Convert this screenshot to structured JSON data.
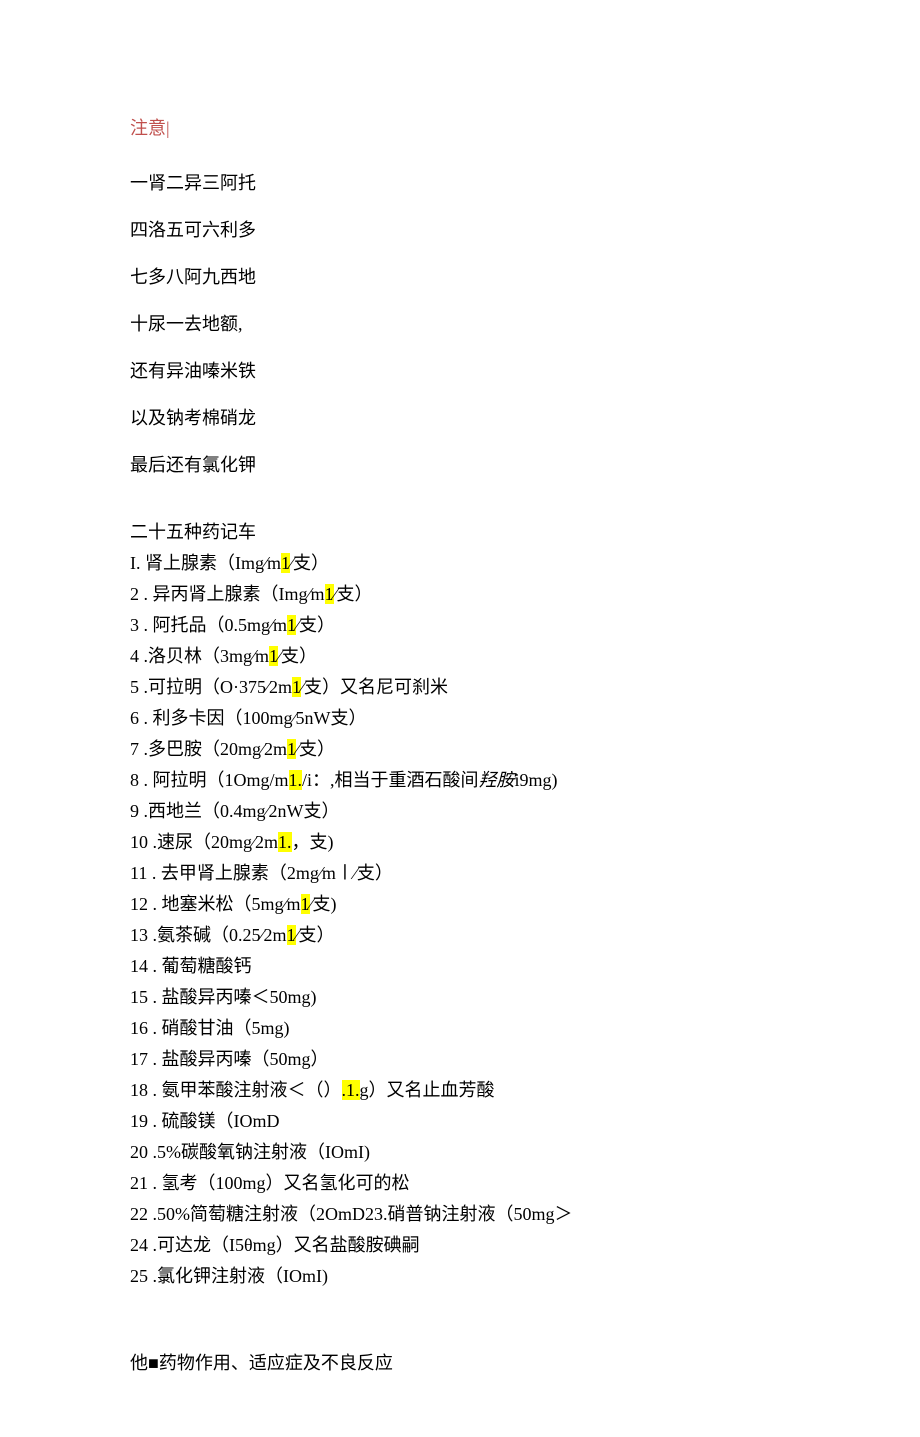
{
  "header": "注意|",
  "mnemonic": [
    "一肾二异三阿托",
    "四洛五可六利多",
    "七多八阿九西地",
    "十尿一去地额,",
    "还有异油嗪米铁",
    "以及钠考棉硝龙",
    "最后还有氯化钾"
  ],
  "list_title": "二十五种药记车",
  "drugs": [
    {
      "num": "I.",
      "pre": " 肾上腺素（Img⁄m",
      "hl": "1",
      "post": "⁄支）"
    },
    {
      "num": "2",
      "pre": " . 异丙肾上腺素（Img⁄m",
      "hl": "1",
      "post": "⁄支）"
    },
    {
      "num": "3",
      "pre": " . 阿托品（0.5mg⁄m",
      "hl": "1",
      "post": "⁄支）"
    },
    {
      "num": "4",
      "pre": " .洛贝林（3mg⁄m",
      "hl": "1",
      "post": "⁄支）"
    },
    {
      "num": "5",
      "pre": " .可拉明（O·375⁄2m",
      "hl": "1",
      "post": "⁄支）又名尼可刹米"
    },
    {
      "num": "6",
      "pre": " . 利多卡因（100mg⁄5nW支）",
      "hl": "",
      "post": ""
    },
    {
      "num": "7",
      "pre": " .多巴胺（20mg⁄2m",
      "hl": "1",
      "post": "⁄支）"
    },
    {
      "num": "8",
      "pre": " . 阿拉明（1Omg/m",
      "hl": "1.",
      "post": "/i：,相当于重酒石酸间",
      "italic": "羟胺",
      "post2": "i9mg)"
    },
    {
      "num": "9",
      "pre": " .西地兰（0.4mg⁄2nW支）",
      "hl": "",
      "post": ""
    },
    {
      "num": "10",
      "pre": " .速尿（20mg⁄2m",
      "hl": "1.",
      "post": "，支)"
    },
    {
      "num": "11",
      "pre": " . 去甲肾上腺素（2mg⁄m㇑⁄支）",
      "hl": "",
      "post": ""
    },
    {
      "num": "12",
      "pre": " . 地塞米松（5mg⁄m",
      "hl": "1",
      "post": "⁄支)"
    },
    {
      "num": "13",
      "pre": " .氨茶碱（0.25⁄2m",
      "hl": "1",
      "post": "⁄支）"
    },
    {
      "num": "14",
      "pre": " . 葡萄糖酸钙",
      "hl": "",
      "post": ""
    },
    {
      "num": "15",
      "pre": " . 盐酸异丙嗪＜50mg)",
      "hl": "",
      "post": ""
    },
    {
      "num": "16",
      "pre": " . 硝酸甘油（5mg)",
      "hl": "",
      "post": ""
    },
    {
      "num": "17",
      "pre": " . 盐酸异丙嗪（50mg）",
      "hl": "",
      "post": ""
    },
    {
      "num": "18",
      "pre": " . 氨甲苯酸注射液＜（）",
      "hl": ".1.",
      "post": "g）又名止血芳酸"
    },
    {
      "num": "19",
      "pre": " . 硫酸镁（IOmD",
      "hl": "",
      "post": ""
    },
    {
      "num": "20",
      "pre": " .5%碳酸氧钠注射液（IOmI)",
      "hl": "",
      "post": ""
    },
    {
      "num": "21",
      "pre": " . 氢考（100mg）又名氢化可的松",
      "hl": "",
      "post": ""
    },
    {
      "num": "22",
      "pre": " .50%简萄糖注射液（2OmD23.硝普钠注射液（50mg＞",
      "hl": "",
      "post": ""
    },
    {
      "num": "24",
      "pre": " .可达龙（I5θmg）又名盐酸胺碘嗣",
      "hl": "",
      "post": ""
    },
    {
      "num": "25",
      "pre": " .氯化钾注射液（IOmI)",
      "hl": "",
      "post": ""
    }
  ],
  "footer": "他■药物作用、适应症及不良反应"
}
